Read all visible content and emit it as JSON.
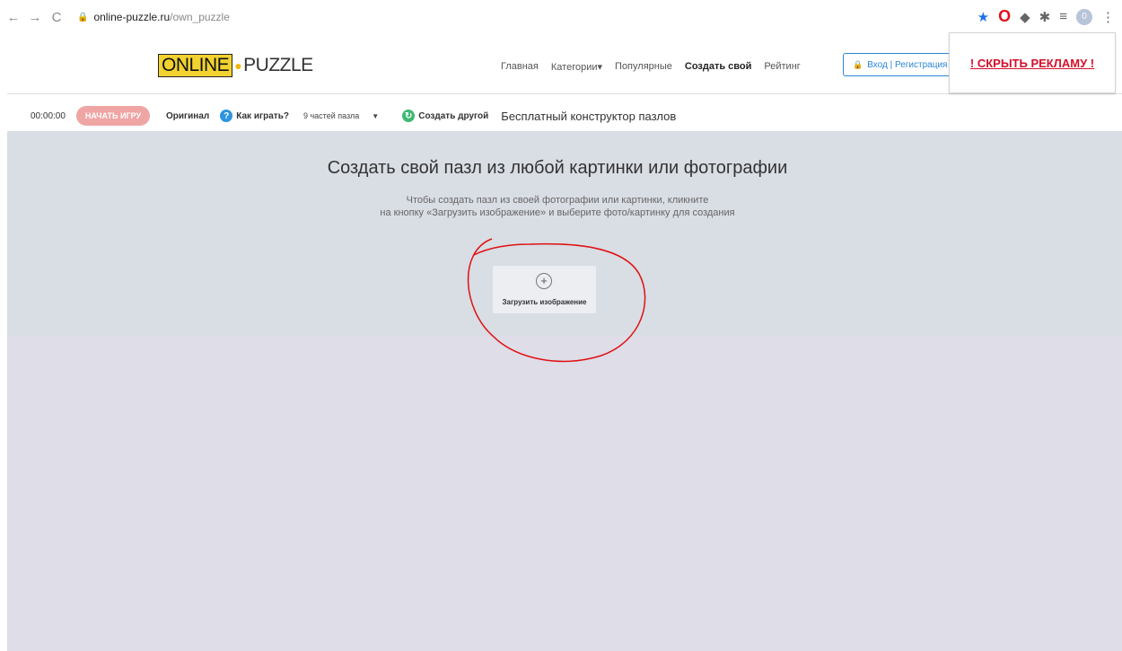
{
  "browser": {
    "url_host": "online-puzzle.ru",
    "url_path": "/own_puzzle",
    "avatar_letter": "0"
  },
  "header": {
    "logo_online": "ONLINE",
    "logo_puzzle": "PUZZLE",
    "nav": [
      "Главная",
      "Категории",
      "Популярные",
      "Создать свой",
      "Рейтинг"
    ],
    "login_label": "Вход | Регистрация",
    "hide_ad_label": "! СКРЫТЬ РЕКЛАМУ !"
  },
  "toolbar": {
    "timer": "00:00:00",
    "start_label": "НАЧАТЬ ИГРУ",
    "original_label": "Оригинал",
    "how_to_play_label": "Как играть?",
    "pieces_label": "9 частей пазла",
    "create_another_label": "Создать другой",
    "title": "Бесплатный конструктор пазлов"
  },
  "main": {
    "title": "Создать свой пазл из любой картинки или фотографии",
    "desc_line1": "Чтобы создать пазл из своей фотографии или картинки, кликните",
    "desc_line2": "на кнопку «Загрузить изображение» и выберите фото/картинку для создания",
    "upload_label": "Загрузить изображение"
  },
  "colors": {
    "accent_blue": "#2c86d8",
    "ad_red": "#d3102a",
    "annotation_red": "#e01010",
    "panel_bg": "#d9dde4"
  }
}
